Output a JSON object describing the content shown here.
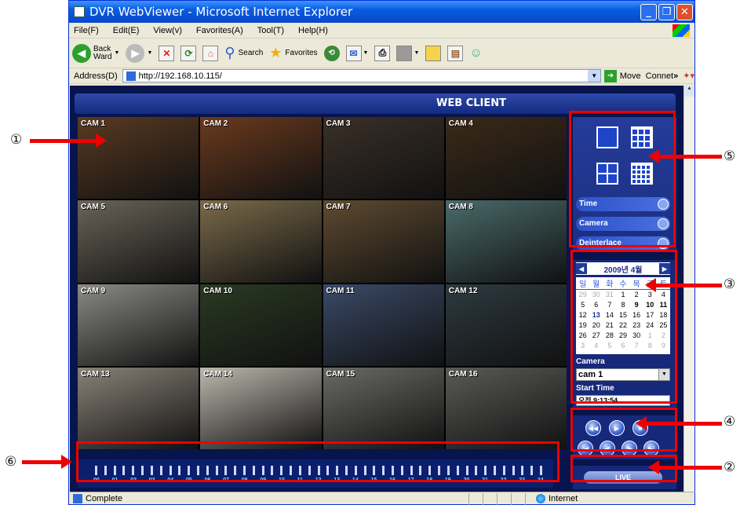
{
  "browser": {
    "title": "DVR WebViewer - Microsoft Internet Explorer",
    "menu": [
      "File(F)",
      "Edit(E)",
      "View(v)",
      "Favorites(A)",
      "Tool(T)",
      "Help(H)"
    ],
    "toolbar": {
      "back": "Back",
      "back_sub": "Ward",
      "search": "Search",
      "favorites": "Favorites"
    },
    "address_label": "Address(D)",
    "url": "http://192.168.10.115/",
    "move": "Move",
    "connect": "Connet",
    "status": "Complete",
    "zone": "Internet"
  },
  "app": {
    "title": "WEB CLIENT",
    "cameras": [
      "CAM 1",
      "CAM 2",
      "CAM 3",
      "CAM 4",
      "CAM 5",
      "CAM 6",
      "CAM 7",
      "CAM 8",
      "CAM 9",
      "CAM 10",
      "CAM 11",
      "CAM 12",
      "CAM 13",
      "CAM 14",
      "CAM 15",
      "CAM 16"
    ],
    "camera_colors": [
      "#5a3a22",
      "#6b3a1e",
      "#3a3028",
      "#3b2a18",
      "#6a6458",
      "#7a6a4a",
      "#5e4a30",
      "#4a6a6a",
      "#8a8a86",
      "#2a3a22",
      "#3a4a68",
      "#2e3a40",
      "#8a8278",
      "#bcb8ae",
      "#6a6a66",
      "#5a5a58"
    ],
    "options": [
      "Time",
      "Camera",
      "Deinterlace"
    ],
    "calendar": {
      "month": "2009년 4월",
      "weekdays": [
        "일",
        "월",
        "화",
        "수",
        "목",
        "금",
        "토"
      ],
      "weeks": [
        [
          "29",
          "30",
          "31",
          "1",
          "2",
          "3",
          "4"
        ],
        [
          "5",
          "6",
          "7",
          "8",
          "9",
          "10",
          "11"
        ],
        [
          "12",
          "13",
          "14",
          "15",
          "16",
          "17",
          "18"
        ],
        [
          "19",
          "20",
          "21",
          "22",
          "23",
          "24",
          "25"
        ],
        [
          "26",
          "27",
          "28",
          "29",
          "30",
          "1",
          "2"
        ],
        [
          "3",
          "4",
          "5",
          "6",
          "7",
          "8",
          "9"
        ]
      ]
    },
    "camera_label": "Camera",
    "camera_value": "cam 1",
    "start_time_label": "Start Time",
    "start_time_value": "오전 9:13:54",
    "live_label": "LIVE",
    "hours": [
      "00",
      "01",
      "02",
      "03",
      "04",
      "05",
      "06",
      "07",
      "08",
      "09",
      "10",
      "11",
      "12",
      "13",
      "14",
      "15",
      "16",
      "17",
      "18",
      "19",
      "20",
      "21",
      "22",
      "23",
      "24"
    ]
  },
  "annotations": [
    "①",
    "②",
    "③",
    "④",
    "⑤",
    "⑥"
  ]
}
